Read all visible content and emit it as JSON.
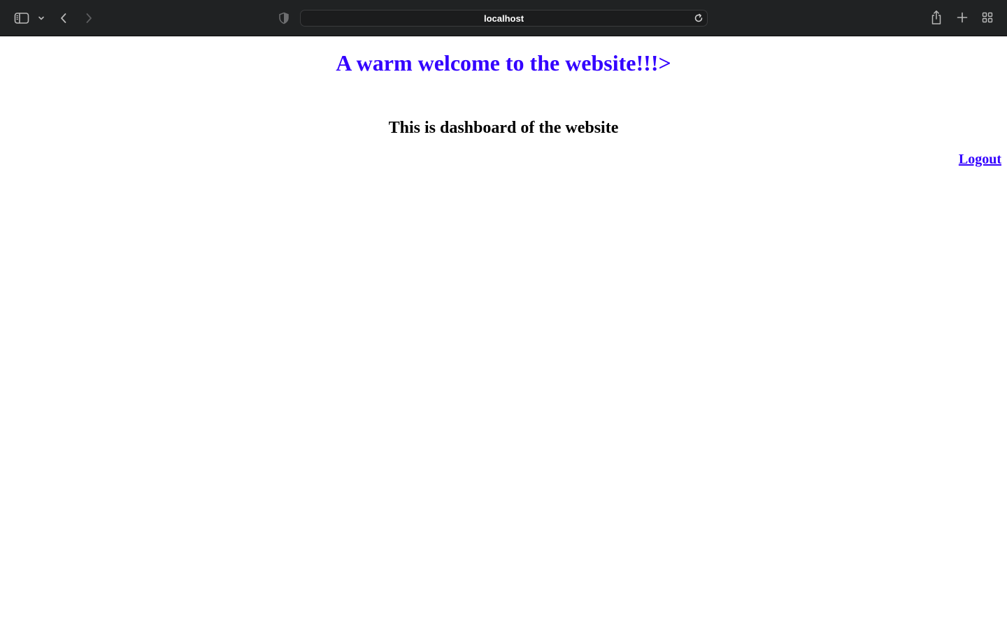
{
  "browser": {
    "url": "localhost",
    "icons": {
      "sidebar": "sidebar-icon",
      "sidebar_menu": "chevron-down-icon",
      "back": "chevron-left-icon",
      "forward": "chevron-right-icon",
      "privacy": "shield-icon",
      "reload": "reload-icon",
      "share": "share-icon",
      "new_tab": "plus-icon",
      "tab_overview": "tab-overview-icon"
    },
    "colors": {
      "toolbar_bg": "#202223",
      "icon": "#b8b8b8"
    }
  },
  "page": {
    "welcome_heading": "A warm welcome to the website!!!>",
    "dashboard_heading": "This is dashboard of the website",
    "logout_link": "Logout",
    "colors": {
      "accent": "#3300ff",
      "text": "#000000",
      "background": "#ffffff"
    }
  }
}
